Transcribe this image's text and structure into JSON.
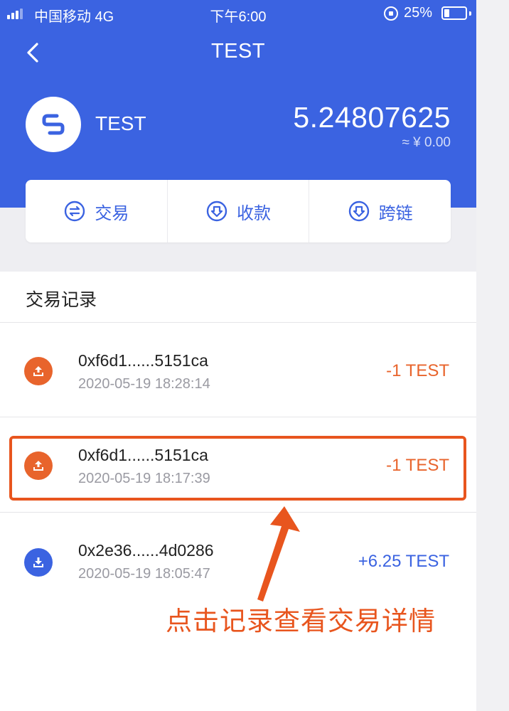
{
  "status_bar": {
    "carrier": "中国移动 4G",
    "time": "下午6:00",
    "battery_pct": "25%",
    "battery_level": 0.25
  },
  "nav": {
    "title": "TEST",
    "back_icon": "chevron-left-icon"
  },
  "token": {
    "name": "TEST",
    "balance": "5.24807625",
    "fiat": "≈ ¥ 0.00",
    "logo_icon": "token-logo-icon"
  },
  "actions": [
    {
      "label": "交易",
      "icon": "swap-icon"
    },
    {
      "label": "收款",
      "icon": "receive-icon"
    },
    {
      "label": "跨链",
      "icon": "cross-chain-icon"
    }
  ],
  "records": {
    "title": "交易记录",
    "items": [
      {
        "hash": "0xf6d1......5151ca",
        "time": "2020-05-19 18:28:14",
        "amount": "-1 TEST",
        "direction": "out",
        "icon": "send-icon"
      },
      {
        "hash": "0xf6d1......5151ca",
        "time": "2020-05-19 18:17:39",
        "amount": "-1 TEST",
        "direction": "out",
        "icon": "send-icon"
      },
      {
        "hash": "0x2e36......4d0286",
        "time": "2020-05-19 18:05:47",
        "amount": "+6.25 TEST",
        "direction": "in",
        "icon": "receive-icon"
      }
    ]
  },
  "annotation": {
    "text": "点击记录查看交易详情",
    "color": "#e8551e"
  },
  "colors": {
    "primary": "#3b63e1",
    "outgoing": "#e8642c",
    "incoming": "#3b63e1"
  }
}
